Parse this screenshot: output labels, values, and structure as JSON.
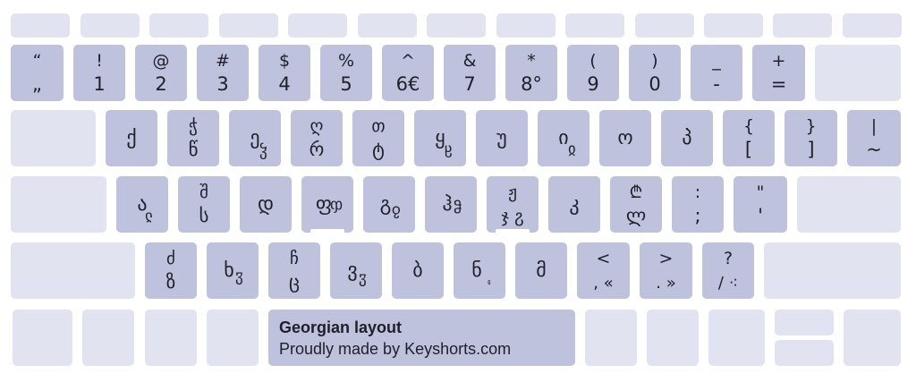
{
  "layout": {
    "title": "Georgian layout",
    "credit": "Proudly made by Keyshorts.com"
  },
  "keys": {
    "tilde": {
      "top": "“",
      "bottom": "„"
    },
    "d1": {
      "top": "!",
      "bottom": "1"
    },
    "d2": {
      "top": "@",
      "bottom": "2"
    },
    "d3": {
      "top": "#",
      "bottom": "3"
    },
    "d4": {
      "top": "$",
      "bottom": "4"
    },
    "d5": {
      "top": "%",
      "bottom": "5"
    },
    "d6": {
      "top": "^",
      "bottom": "6€"
    },
    "d7": {
      "top": "&",
      "bottom": "7"
    },
    "d8": {
      "top": "*",
      "bottom": "8°"
    },
    "d9": {
      "top": "(",
      "bottom": "9"
    },
    "d0": {
      "top": ")",
      "bottom": "0"
    },
    "minus": {
      "top": "_",
      "bottom": "-"
    },
    "equal": {
      "top": "+",
      "bottom": "="
    },
    "q": {
      "main": "ქ"
    },
    "w": {
      "top": "ჭ",
      "bottom": "წ"
    },
    "e": {
      "main": "ე",
      "sub": "ჴ"
    },
    "r": {
      "top": "ღ",
      "bottom": "რ"
    },
    "t": {
      "top": "თ",
      "bottom": "ტ"
    },
    "y": {
      "main": "ყ",
      "sub": "ჸ"
    },
    "u": {
      "main": "უ"
    },
    "i": {
      "main": "ი",
      "sub": "ჲ"
    },
    "o": {
      "main": "ო"
    },
    "p": {
      "main": "პ"
    },
    "lbracket": {
      "top": "{",
      "bottom": "["
    },
    "rbracket": {
      "top": "}",
      "bottom": "]"
    },
    "backslash": {
      "top": "|",
      "bottom": "~"
    },
    "a": {
      "main": "ა",
      "sub": "ჺ"
    },
    "s": {
      "top": "შ",
      "bottom": "ს"
    },
    "d": {
      "main": "დ"
    },
    "f": {
      "main": "ფ",
      "sub": "ჶ"
    },
    "g": {
      "main": "გ",
      "sub": "ჹ"
    },
    "h": {
      "main": "ჰ",
      "sub": "ჵ"
    },
    "j": {
      "top": "ჟ",
      "bottom": "ჯ ჷ"
    },
    "k": {
      "main": "კ"
    },
    "l": {
      "top": "₾",
      "bottom": "ლ"
    },
    "semicolon": {
      "top": ":",
      "bottom": ";"
    },
    "quote": {
      "top": "\"",
      "bottom": "'"
    },
    "z": {
      "top": "ძ",
      "bottom": "ზ"
    },
    "x": {
      "main": "ხ",
      "sub": "ჳ"
    },
    "c": {
      "top": "ჩ",
      "bottom": "ც"
    },
    "v": {
      "main": "ვ",
      "sub": "ჳ"
    },
    "b": {
      "main": "ბ"
    },
    "n": {
      "main": "ნ",
      "sub": "ჼ"
    },
    "m": {
      "main": "მ"
    },
    "comma": {
      "top": "<",
      "bottom": ", «"
    },
    "period": {
      "top": ">",
      "bottom": ". »"
    },
    "slash": {
      "top": "?",
      "bottom": "/ ⁖"
    }
  }
}
